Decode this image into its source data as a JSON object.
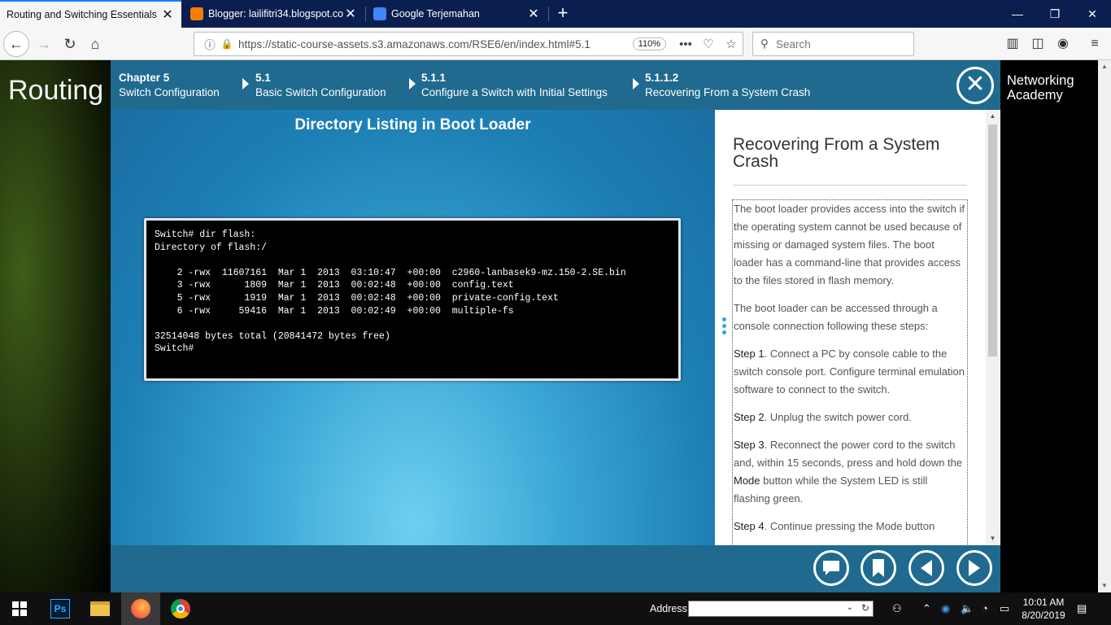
{
  "browser": {
    "tabs": [
      {
        "title": "Routing and Switching Essentials",
        "active": true
      },
      {
        "title": "Blogger: lailifitri34.blogspot.co",
        "active": false
      },
      {
        "title": "Google Terjemahan",
        "active": false
      }
    ],
    "url": "https://static-course-assets.s3.amazonaws.com/RSE6/en/index.html#5.1",
    "zoom": "110%",
    "search_placeholder": "Search"
  },
  "page": {
    "left_title": "Routing and Switching Essentials",
    "logo_line1": "Networking",
    "logo_line2": "Academy"
  },
  "breadcrumb": [
    {
      "num": "Chapter 5",
      "label": "Switch Configuration"
    },
    {
      "num": "5.1",
      "label": "Basic Switch Configuration"
    },
    {
      "num": "5.1.1",
      "label": "Configure a Switch with Initial Settings"
    },
    {
      "num": "5.1.1.2",
      "label": "Recovering From a System Crash"
    }
  ],
  "slide": {
    "title": "Directory Listing in Boot Loader",
    "terminal": "Switch# dir flash:\nDirectory of flash:/\n\n    2 -rwx  11607161  Mar 1  2013  03:10:47  +00:00  c2960-lanbasek9-mz.150-2.SE.bin\n    3 -rwx      1809  Mar 1  2013  00:02:48  +00:00  config.text\n    5 -rwx      1919  Mar 1  2013  00:02:48  +00:00  private-config.text\n    6 -rwx     59416  Mar 1  2013  00:02:49  +00:00  multiple-fs\n\n32514048 bytes total (20841472 bytes free)\nSwitch#"
  },
  "text_panel": {
    "title": "Recovering From a System Crash",
    "para1": "The boot loader provides access into the switch if the operating system cannot be used because of missing or damaged system files. The boot loader has a command-line that provides access to the files stored in flash memory.",
    "para2": "The boot loader can be accessed through a console connection following these steps:",
    "step1_label": "Step 1",
    "step1_text": ". Connect a PC by console cable to the switch console port. Configure terminal emulation software to connect to the switch.",
    "step2_label": "Step 2",
    "step2_text": ". Unplug the switch power cord.",
    "step3_label": "Step 3",
    "step3_text_a": ". Reconnect the power cord to the switch and, within 15 seconds, press and hold down the ",
    "step3_mode": "Mode",
    "step3_text_b": " button while the System LED is still flashing green.",
    "step4_label": "Step 4",
    "step4_text": ". Continue pressing the Mode button"
  },
  "taskbar": {
    "address_label": "Address",
    "time": "10:01 AM",
    "date": "8/20/2019"
  }
}
